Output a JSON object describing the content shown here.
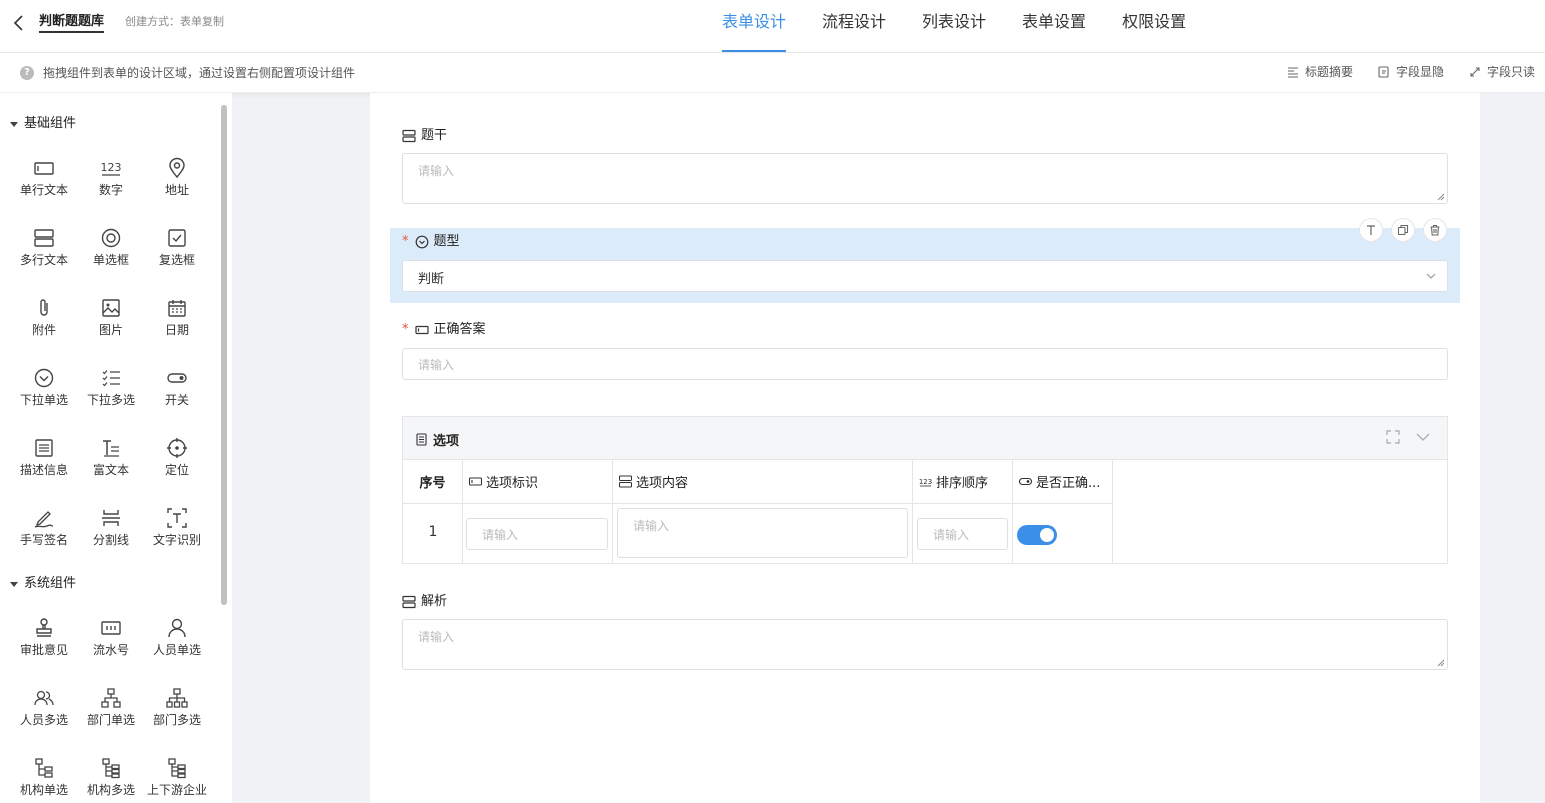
{
  "header": {
    "title": "判断题题库",
    "created": "创建方式：表单复制",
    "tabs": [
      {
        "label": "表单设计",
        "active": true
      },
      {
        "label": "流程设计",
        "active": false
      },
      {
        "label": "列表设计",
        "active": false
      },
      {
        "label": "表单设置",
        "active": false
      },
      {
        "label": "权限设置",
        "active": false
      }
    ]
  },
  "hintbar": {
    "icon": "question-icon",
    "text": "拖拽组件到表单的设计区域，通过设置右侧配置项设计组件",
    "actions": [
      {
        "label": "标题摘要",
        "icon": "title-summary-icon"
      },
      {
        "label": "字段显隐",
        "icon": "field-visibility-icon"
      },
      {
        "label": "字段只读",
        "icon": "field-readonly-icon"
      }
    ]
  },
  "sidebar": {
    "groups": [
      {
        "title": "基础组件",
        "items": [
          {
            "label": "单行文本",
            "icon": "single-line-icon"
          },
          {
            "label": "数字",
            "icon": "number-icon"
          },
          {
            "label": "地址",
            "icon": "location-pin-icon"
          },
          {
            "label": "多行文本",
            "icon": "multi-line-icon"
          },
          {
            "label": "单选框",
            "icon": "radio-icon"
          },
          {
            "label": "复选框",
            "icon": "checkbox-icon"
          },
          {
            "label": "附件",
            "icon": "paperclip-icon"
          },
          {
            "label": "图片",
            "icon": "image-icon"
          },
          {
            "label": "日期",
            "icon": "calendar-icon"
          },
          {
            "label": "下拉单选",
            "icon": "dropdown-icon"
          },
          {
            "label": "下拉多选",
            "icon": "checklist-icon"
          },
          {
            "label": "开关",
            "icon": "switch-icon"
          },
          {
            "label": "描述信息",
            "icon": "description-icon"
          },
          {
            "label": "富文本",
            "icon": "rich-text-icon"
          },
          {
            "label": "定位",
            "icon": "crosshair-icon"
          },
          {
            "label": "手写签名",
            "icon": "signature-icon"
          },
          {
            "label": "分割线",
            "icon": "divider-icon"
          },
          {
            "label": "文字识别",
            "icon": "ocr-icon"
          }
        ]
      },
      {
        "title": "系统组件",
        "items": [
          {
            "label": "审批意见",
            "icon": "stamp-icon"
          },
          {
            "label": "流水号",
            "icon": "serial-number-icon"
          },
          {
            "label": "人员单选",
            "icon": "user-icon"
          },
          {
            "label": "人员多选",
            "icon": "users-icon"
          },
          {
            "label": "部门单选",
            "icon": "org-chart-icon"
          },
          {
            "label": "部门多选",
            "icon": "org-chart-multi-icon"
          },
          {
            "label": "机构单选",
            "icon": "tree-icon"
          },
          {
            "label": "机构多选",
            "icon": "tree-multi-icon"
          },
          {
            "label": "上下游企业",
            "icon": "tree-chain-icon"
          }
        ]
      }
    ]
  },
  "form": {
    "stem": {
      "label": "题干",
      "placeholder": "请输入"
    },
    "type": {
      "label": "题型",
      "required": "*",
      "value": "判断"
    },
    "answer": {
      "label": "正确答案",
      "required": "*",
      "placeholder": "请输入"
    },
    "options": {
      "title": "选项",
      "columns": [
        "序号",
        "选项标识",
        "选项内容",
        "排序顺序",
        "是否正确..."
      ],
      "rows": [
        {
          "index": "1",
          "mark_placeholder": "请输入",
          "content_placeholder": "请输入",
          "order_placeholder": "请输入",
          "correct": true
        }
      ]
    },
    "analysis": {
      "label": "解析",
      "placeholder": "请输入"
    }
  },
  "colors": {
    "accent": "#3c8fe6",
    "selected_bg": "#dcebfa",
    "required": "#e5533f"
  }
}
